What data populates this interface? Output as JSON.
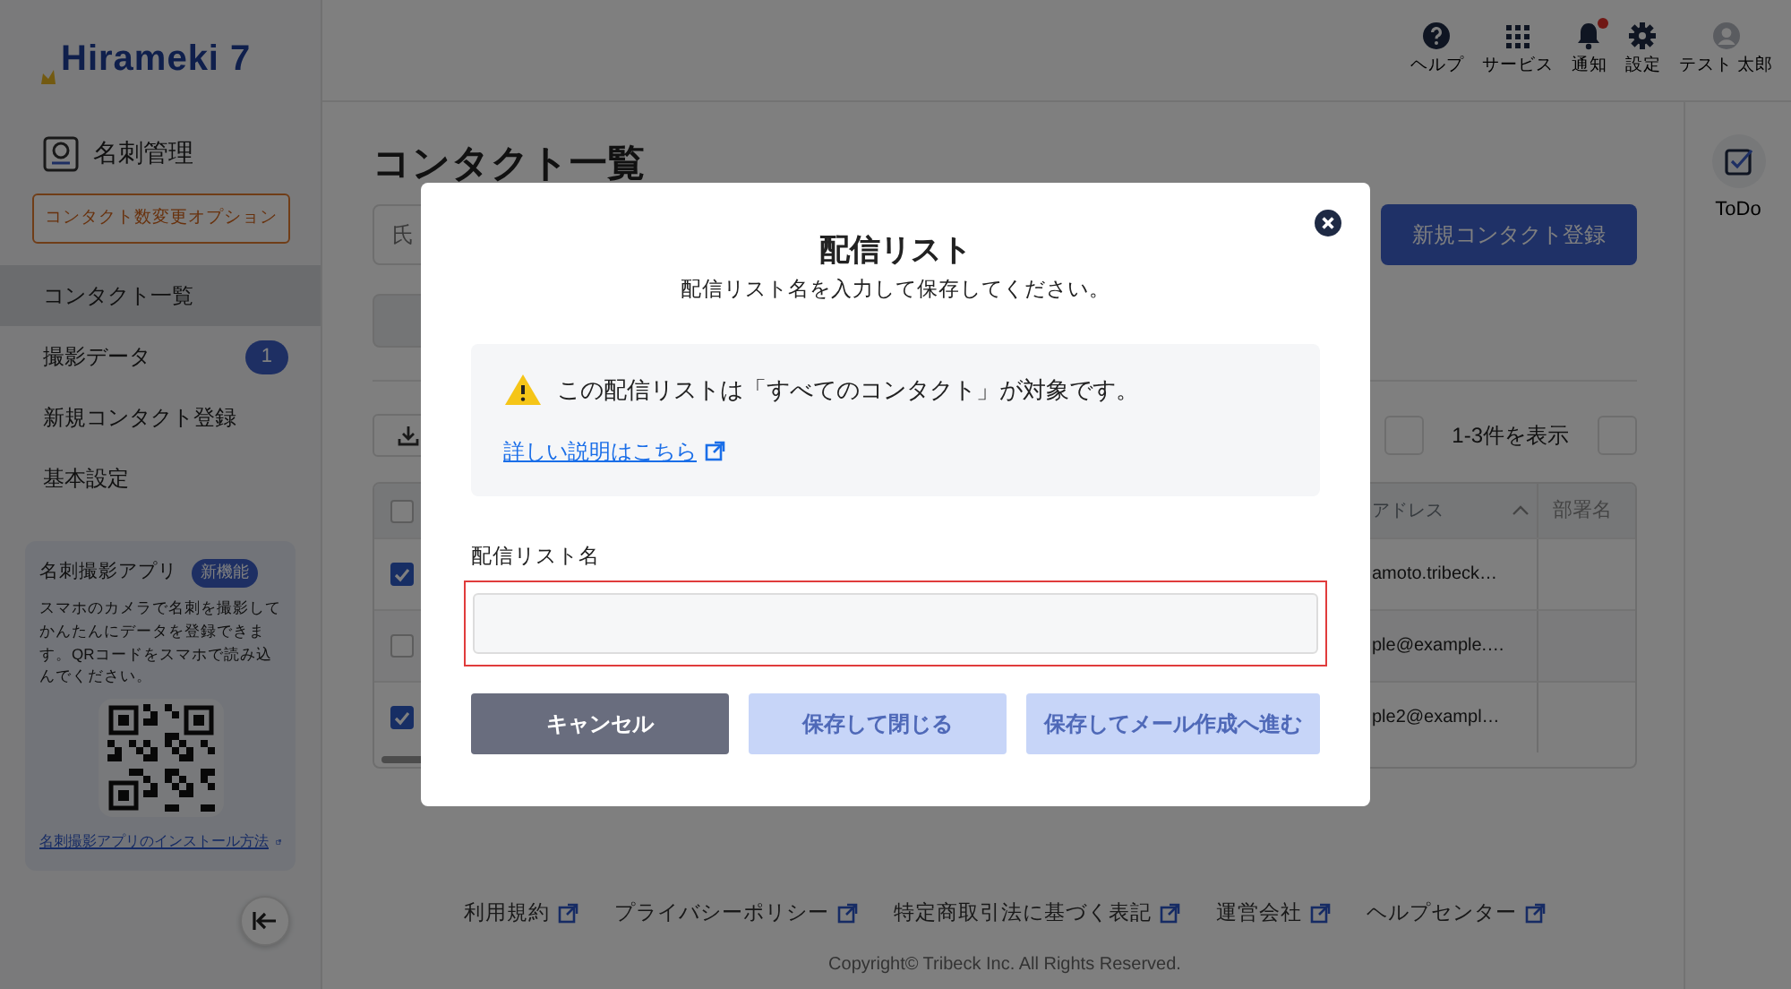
{
  "header": {
    "logo": "Hirameki 7",
    "actions": [
      {
        "label": "ヘルプ",
        "kind": "help",
        "unread": false
      },
      {
        "label": "サービス",
        "kind": "apps",
        "unread": false
      },
      {
        "label": "通知",
        "kind": "bell",
        "unread": true
      },
      {
        "label": "設定",
        "kind": "gear",
        "unread": false
      },
      {
        "label": "テスト 太郎",
        "kind": "user",
        "unread": false
      }
    ]
  },
  "sidebar": {
    "section": "名刺管理",
    "option_button": "コンタクト数変更オプション",
    "items": [
      {
        "label": "コンタクト一覧",
        "selected": true
      },
      {
        "label": "撮影データ",
        "selected": false,
        "badge": "1"
      },
      {
        "label": "新規コンタクト登録",
        "selected": false
      },
      {
        "label": "基本設定",
        "selected": false
      }
    ],
    "app_card": {
      "title": "名刺撮影アプリ",
      "badge": "新機能",
      "text": "スマホのカメラで名刺を撮影してかんたんにデータを登録できます。QRコードをスマホで読み込んでください。",
      "link": "名刺撮影アプリのインストール方法"
    }
  },
  "main": {
    "title": "コンタクト一覧",
    "search_placeholder": "氏",
    "new_button": "新規コンタクト登録",
    "range": "1-3件を表示",
    "header_checked": false,
    "columns": [
      {
        "label": "アドレス",
        "sorted": true
      },
      {
        "label": "部署名",
        "sorted": false
      }
    ],
    "rows": [
      {
        "email": "amoto.tribeck…",
        "checked": true
      },
      {
        "email": "ple@example.…",
        "checked": false
      },
      {
        "email": "ple2@exampl…",
        "checked": true
      }
    ]
  },
  "todo": {
    "label": "ToDo"
  },
  "footer": {
    "links": [
      "利用規約",
      "プライバシーポリシー",
      "特定商取引法に基づく表記",
      "運営会社",
      "ヘルプセンター"
    ],
    "copyright": "Copyright© Tribeck Inc. All Rights Reserved."
  },
  "modal": {
    "title": "配信リスト",
    "subtitle": "配信リスト名を入力して保存してください。",
    "notice": "この配信リストは「すべてのコンタクト」が対象です。",
    "notice_link": "詳しい説明はこちら",
    "field_label": "配信リスト名",
    "field_invalid": true,
    "buttons": [
      {
        "label": "キャンセル",
        "kind": "secondary",
        "disabled": false
      },
      {
        "label": "保存して閉じる",
        "kind": "primary",
        "disabled": true
      },
      {
        "label": "保存してメール作成へ進む",
        "kind": "primary",
        "disabled": true
      }
    ]
  }
}
